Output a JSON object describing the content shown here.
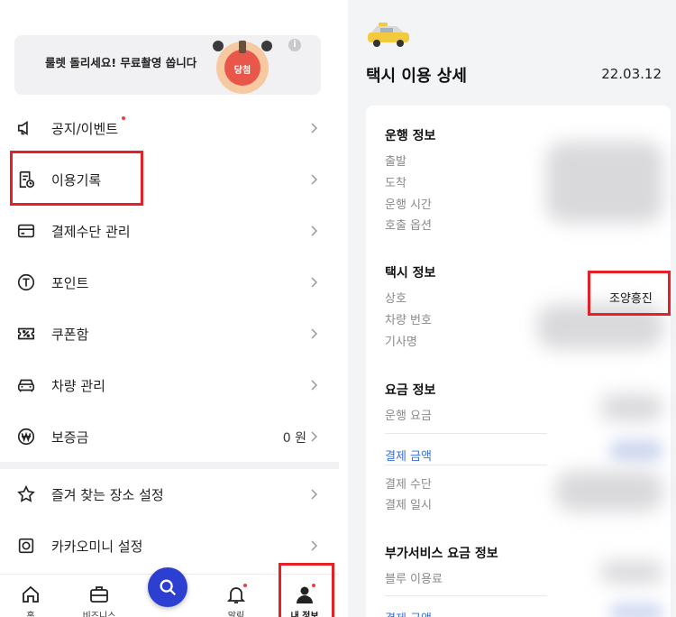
{
  "left": {
    "banner": {
      "title": "룰렛 돌리세요! 무료촬영 쏩니다",
      "subtitle": "",
      "roulette_label": "당첨",
      "info_icon": "info-icon"
    },
    "menu": [
      {
        "name": "menu-notice",
        "label": "공지/이벤트",
        "icon": "megaphone-icon",
        "has_dot": true,
        "value": ""
      },
      {
        "name": "menu-history",
        "label": "이용기록",
        "icon": "receipt-clock-icon",
        "has_dot": false,
        "value": ""
      },
      {
        "name": "menu-payment",
        "label": "결제수단 관리",
        "icon": "card-icon",
        "has_dot": false,
        "value": ""
      },
      {
        "name": "menu-point",
        "label": "포인트",
        "icon": "point-coin-icon",
        "has_dot": false,
        "value": ""
      },
      {
        "name": "menu-coupon",
        "label": "쿠폰함",
        "icon": "coupon-icon",
        "has_dot": false,
        "value": ""
      },
      {
        "name": "menu-car",
        "label": "차량 관리",
        "icon": "car-icon",
        "has_dot": false,
        "value": ""
      },
      {
        "name": "menu-deposit",
        "label": "보증금",
        "icon": "won-icon",
        "has_dot": false,
        "value": "0 원"
      },
      {
        "name": "menu-favorites",
        "label": "즐겨 찾는 장소 설정",
        "icon": "star-icon",
        "has_dot": false,
        "value": ""
      },
      {
        "name": "menu-kakaomini",
        "label": "카카오미니 설정",
        "icon": "speaker-icon",
        "has_dot": false,
        "value": ""
      }
    ],
    "tabbar": [
      {
        "name": "tab-home",
        "label": "홈",
        "icon": "home-icon"
      },
      {
        "name": "tab-business",
        "label": "비즈니스",
        "icon": "briefcase-icon"
      },
      {
        "name": "tab-alerts",
        "label": "알림",
        "icon": "bell-icon"
      },
      {
        "name": "tab-my-info",
        "label": "내 정보",
        "icon": "person-icon"
      }
    ],
    "fab_icon": "search-icon"
  },
  "right": {
    "icon": "taxi-icon",
    "title": "택시 이용 상세",
    "date": "22.03.12",
    "sections": {
      "drive": {
        "title": "운행 정보",
        "rows": [
          "출발",
          "도착",
          "운행 시간",
          "호출 옵션"
        ]
      },
      "taxi": {
        "title": "택시 정보",
        "rows": [
          "상호",
          "차량 번호",
          "기사명"
        ],
        "company_value": "조양흥진"
      },
      "fare": {
        "title": "요금 정보",
        "rows": [
          "운행 요금"
        ],
        "pay_amount_label": "결제 금액",
        "pay_rows": [
          "결제 수단",
          "결제 일시"
        ]
      },
      "extra": {
        "title": "부가서비스 요금 정보",
        "rows": [
          "블루 이용료"
        ],
        "pay_amount_label": "결제 금액"
      }
    }
  },
  "colors": {
    "highlight": "#e52127",
    "accent_blue": "#2d3fd0",
    "link_blue": "#3b6fd4",
    "notify_dot": "#e8413a"
  }
}
